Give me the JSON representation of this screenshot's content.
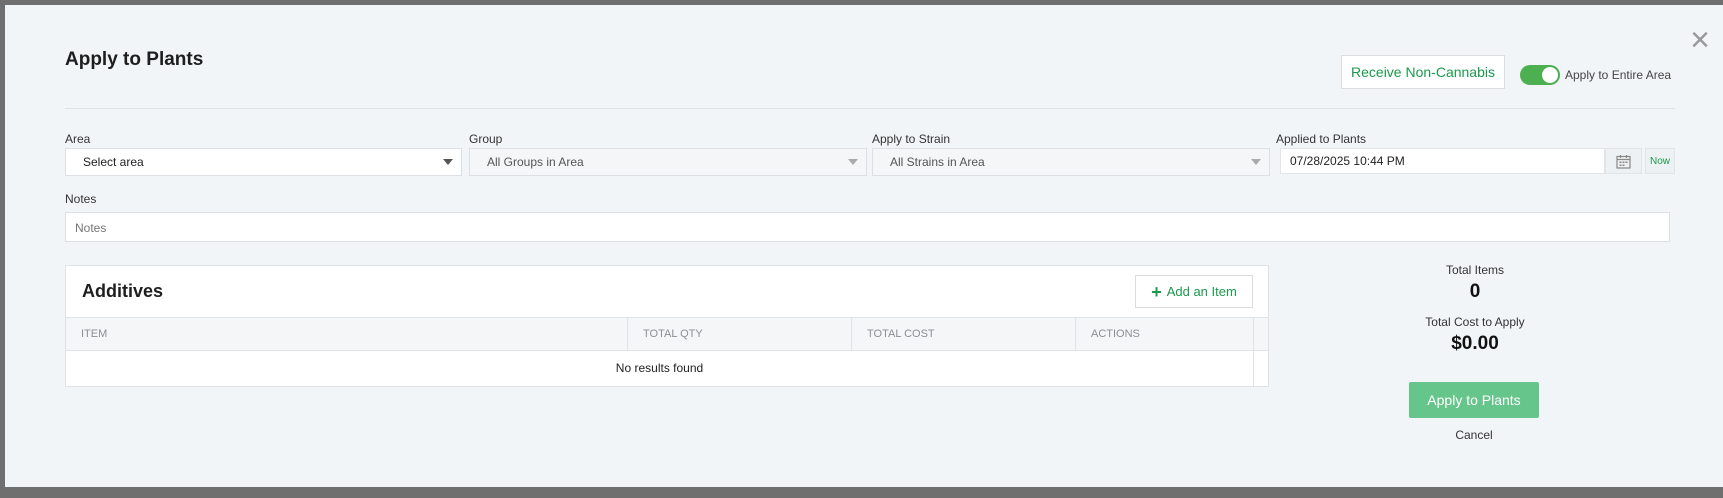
{
  "modal": {
    "title": "Apply to Plants",
    "close_label": "×",
    "receive_button": "Receive Non-Cannabis",
    "toggle_label": "Apply to Entire Area",
    "toggle_on": true
  },
  "fields": {
    "area": {
      "label": "Area",
      "value": "Select area"
    },
    "group": {
      "label": "Group",
      "value": "All Groups in Area"
    },
    "strain": {
      "label": "Apply to Strain",
      "value": "All Strains in Area"
    },
    "applied": {
      "label": "Applied to Plants",
      "value": "07/28/2025 10:44 PM",
      "now_label": "Now"
    },
    "notes": {
      "label": "Notes",
      "placeholder": "Notes"
    }
  },
  "additives": {
    "title": "Additives",
    "add_button": "Add an Item",
    "columns": [
      "ITEM",
      "TOTAL QTY",
      "TOTAL COST",
      "ACTIONS"
    ],
    "empty_text": "No results found"
  },
  "summary": {
    "total_items_label": "Total Items",
    "total_items_value": "0",
    "total_cost_label": "Total Cost to Apply",
    "total_cost_value": "$0.00",
    "apply_button": "Apply to Plants",
    "cancel_label": "Cancel"
  },
  "colors": {
    "accent": "#1a9a4c",
    "apply_button_bg": "#66c58a",
    "toggle_on": "#4caf50"
  }
}
